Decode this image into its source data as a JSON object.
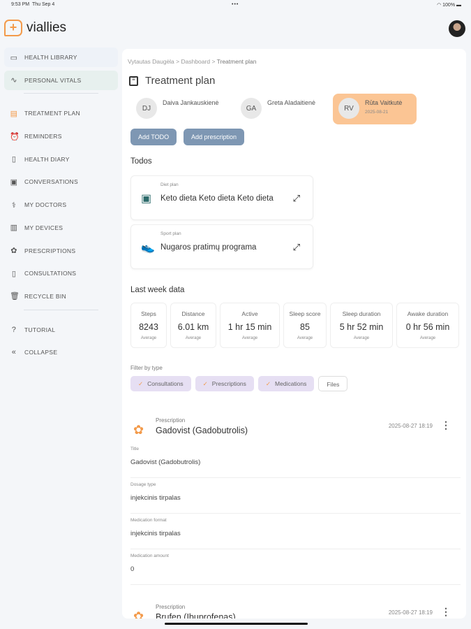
{
  "status": {
    "time": "9:53 PM",
    "date": "Thu Sep 4",
    "dots": "•••",
    "battery": "100%"
  },
  "app": {
    "name": "viallies"
  },
  "sidebar": {
    "items": [
      {
        "label": "HEALTH LIBRARY",
        "icon": "archive-icon",
        "glyph": "▭"
      },
      {
        "label": "PERSONAL VITALS",
        "icon": "pulse-icon",
        "glyph": "∿"
      },
      {
        "label": "TREATMENT PLAN",
        "icon": "clipboard-icon",
        "glyph": "▤"
      },
      {
        "label": "REMINDERS",
        "icon": "alarm-icon",
        "glyph": "⏰"
      },
      {
        "label": "HEALTH DIARY",
        "icon": "book-icon",
        "glyph": "▯"
      },
      {
        "label": "CONVERSATIONS",
        "icon": "chat-icon",
        "glyph": "▣"
      },
      {
        "label": "MY DOCTORS",
        "icon": "stethoscope-icon",
        "glyph": "⚕"
      },
      {
        "label": "MY DEVICES",
        "icon": "devices-icon",
        "glyph": "▥"
      },
      {
        "label": "PRESCRIPTIONS",
        "icon": "pills-icon",
        "glyph": "✿"
      },
      {
        "label": "CONSULTATIONS",
        "icon": "book-open-icon",
        "glyph": "▯"
      },
      {
        "label": "RECYCLE BIN",
        "icon": "trash-icon",
        "glyph": "🗑"
      },
      {
        "label": "TUTORIAL",
        "icon": "help-icon",
        "glyph": "?"
      },
      {
        "label": "COLLAPSE",
        "icon": "collapse-icon",
        "glyph": "«"
      }
    ]
  },
  "breadcrumb": [
    "Vytautas Daugėla",
    "Dashboard",
    "Treatment plan"
  ],
  "page_title": "Treatment plan",
  "patients": [
    {
      "initials": "DJ",
      "name": "Daiva Jankauskienė",
      "date": ""
    },
    {
      "initials": "GA",
      "name": "Greta Aladaitienė",
      "date": ""
    },
    {
      "initials": "RV",
      "name": "Rūta Vaitkutė",
      "date": "2025-08-21"
    }
  ],
  "buttons": {
    "add_todo": "Add TODO",
    "add_prescription": "Add prescription"
  },
  "todos": {
    "heading": "Todos",
    "items": [
      {
        "type": "Diet plan",
        "text": "Keto dieta Keto dieta Keto dieta"
      },
      {
        "type": "Sport plan",
        "text": "Nugaros pratimų programa"
      }
    ]
  },
  "last_week": {
    "heading": "Last week data",
    "stats": [
      {
        "label": "Steps",
        "value": "8243",
        "sub": "Average"
      },
      {
        "label": "Distance",
        "value": "6.01 km",
        "sub": "Average"
      },
      {
        "label": "Active",
        "value": "1 hr 15 min",
        "sub": "Average"
      },
      {
        "label": "Sleep score",
        "value": "85",
        "sub": "Average"
      },
      {
        "label": "Sleep duration",
        "value": "5 hr 52 min",
        "sub": "Average"
      },
      {
        "label": "Awake duration",
        "value": "0 hr 56 min",
        "sub": "Average"
      }
    ]
  },
  "filter": {
    "label": "Filter by type",
    "chips": [
      {
        "label": "Consultations",
        "checked": true
      },
      {
        "label": "Prescriptions",
        "checked": true
      },
      {
        "label": "Medications",
        "checked": true
      },
      {
        "label": "Files",
        "checked": false
      }
    ]
  },
  "prescriptions": [
    {
      "kind": "Prescription",
      "name": "Gadovist (Gadobutrolis)",
      "date": "2025-08-27 18:19",
      "fields": [
        {
          "label": "Title",
          "value": "Gadovist (Gadobutrolis)"
        },
        {
          "label": "Dosage type",
          "value": "injekcinis tirpalas"
        },
        {
          "label": "Medication format",
          "value": "injekcinis tirpalas"
        },
        {
          "label": "Medication amount",
          "value": "0"
        }
      ]
    },
    {
      "kind": "Prescription",
      "name": "Brufen (Ibuprofenas)",
      "date": "2025-08-27 18:19"
    }
  ]
}
